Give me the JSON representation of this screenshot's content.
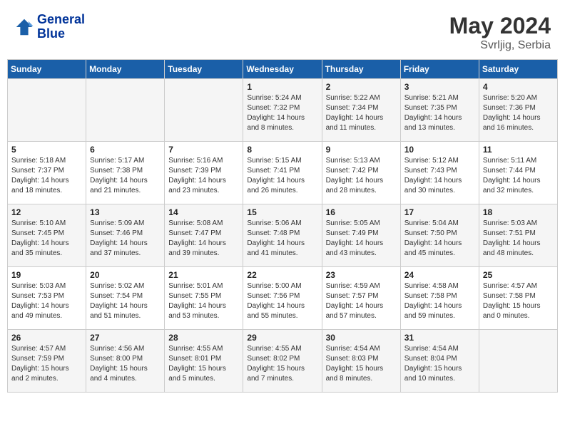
{
  "header": {
    "logo_line1": "General",
    "logo_line2": "Blue",
    "month_year": "May 2024",
    "location": "Svrljig, Serbia"
  },
  "days_of_week": [
    "Sunday",
    "Monday",
    "Tuesday",
    "Wednesday",
    "Thursday",
    "Friday",
    "Saturday"
  ],
  "weeks": [
    [
      {
        "day": "",
        "sunrise": "",
        "sunset": "",
        "daylight": ""
      },
      {
        "day": "",
        "sunrise": "",
        "sunset": "",
        "daylight": ""
      },
      {
        "day": "",
        "sunrise": "",
        "sunset": "",
        "daylight": ""
      },
      {
        "day": "1",
        "sunrise": "Sunrise: 5:24 AM",
        "sunset": "Sunset: 7:32 PM",
        "daylight": "Daylight: 14 hours and 8 minutes."
      },
      {
        "day": "2",
        "sunrise": "Sunrise: 5:22 AM",
        "sunset": "Sunset: 7:34 PM",
        "daylight": "Daylight: 14 hours and 11 minutes."
      },
      {
        "day": "3",
        "sunrise": "Sunrise: 5:21 AM",
        "sunset": "Sunset: 7:35 PM",
        "daylight": "Daylight: 14 hours and 13 minutes."
      },
      {
        "day": "4",
        "sunrise": "Sunrise: 5:20 AM",
        "sunset": "Sunset: 7:36 PM",
        "daylight": "Daylight: 14 hours and 16 minutes."
      }
    ],
    [
      {
        "day": "5",
        "sunrise": "Sunrise: 5:18 AM",
        "sunset": "Sunset: 7:37 PM",
        "daylight": "Daylight: 14 hours and 18 minutes."
      },
      {
        "day": "6",
        "sunrise": "Sunrise: 5:17 AM",
        "sunset": "Sunset: 7:38 PM",
        "daylight": "Daylight: 14 hours and 21 minutes."
      },
      {
        "day": "7",
        "sunrise": "Sunrise: 5:16 AM",
        "sunset": "Sunset: 7:39 PM",
        "daylight": "Daylight: 14 hours and 23 minutes."
      },
      {
        "day": "8",
        "sunrise": "Sunrise: 5:15 AM",
        "sunset": "Sunset: 7:41 PM",
        "daylight": "Daylight: 14 hours and 26 minutes."
      },
      {
        "day": "9",
        "sunrise": "Sunrise: 5:13 AM",
        "sunset": "Sunset: 7:42 PM",
        "daylight": "Daylight: 14 hours and 28 minutes."
      },
      {
        "day": "10",
        "sunrise": "Sunrise: 5:12 AM",
        "sunset": "Sunset: 7:43 PM",
        "daylight": "Daylight: 14 hours and 30 minutes."
      },
      {
        "day": "11",
        "sunrise": "Sunrise: 5:11 AM",
        "sunset": "Sunset: 7:44 PM",
        "daylight": "Daylight: 14 hours and 32 minutes."
      }
    ],
    [
      {
        "day": "12",
        "sunrise": "Sunrise: 5:10 AM",
        "sunset": "Sunset: 7:45 PM",
        "daylight": "Daylight: 14 hours and 35 minutes."
      },
      {
        "day": "13",
        "sunrise": "Sunrise: 5:09 AM",
        "sunset": "Sunset: 7:46 PM",
        "daylight": "Daylight: 14 hours and 37 minutes."
      },
      {
        "day": "14",
        "sunrise": "Sunrise: 5:08 AM",
        "sunset": "Sunset: 7:47 PM",
        "daylight": "Daylight: 14 hours and 39 minutes."
      },
      {
        "day": "15",
        "sunrise": "Sunrise: 5:06 AM",
        "sunset": "Sunset: 7:48 PM",
        "daylight": "Daylight: 14 hours and 41 minutes."
      },
      {
        "day": "16",
        "sunrise": "Sunrise: 5:05 AM",
        "sunset": "Sunset: 7:49 PM",
        "daylight": "Daylight: 14 hours and 43 minutes."
      },
      {
        "day": "17",
        "sunrise": "Sunrise: 5:04 AM",
        "sunset": "Sunset: 7:50 PM",
        "daylight": "Daylight: 14 hours and 45 minutes."
      },
      {
        "day": "18",
        "sunrise": "Sunrise: 5:03 AM",
        "sunset": "Sunset: 7:51 PM",
        "daylight": "Daylight: 14 hours and 48 minutes."
      }
    ],
    [
      {
        "day": "19",
        "sunrise": "Sunrise: 5:03 AM",
        "sunset": "Sunset: 7:53 PM",
        "daylight": "Daylight: 14 hours and 49 minutes."
      },
      {
        "day": "20",
        "sunrise": "Sunrise: 5:02 AM",
        "sunset": "Sunset: 7:54 PM",
        "daylight": "Daylight: 14 hours and 51 minutes."
      },
      {
        "day": "21",
        "sunrise": "Sunrise: 5:01 AM",
        "sunset": "Sunset: 7:55 PM",
        "daylight": "Daylight: 14 hours and 53 minutes."
      },
      {
        "day": "22",
        "sunrise": "Sunrise: 5:00 AM",
        "sunset": "Sunset: 7:56 PM",
        "daylight": "Daylight: 14 hours and 55 minutes."
      },
      {
        "day": "23",
        "sunrise": "Sunrise: 4:59 AM",
        "sunset": "Sunset: 7:57 PM",
        "daylight": "Daylight: 14 hours and 57 minutes."
      },
      {
        "day": "24",
        "sunrise": "Sunrise: 4:58 AM",
        "sunset": "Sunset: 7:58 PM",
        "daylight": "Daylight: 14 hours and 59 minutes."
      },
      {
        "day": "25",
        "sunrise": "Sunrise: 4:57 AM",
        "sunset": "Sunset: 7:58 PM",
        "daylight": "Daylight: 15 hours and 0 minutes."
      }
    ],
    [
      {
        "day": "26",
        "sunrise": "Sunrise: 4:57 AM",
        "sunset": "Sunset: 7:59 PM",
        "daylight": "Daylight: 15 hours and 2 minutes."
      },
      {
        "day": "27",
        "sunrise": "Sunrise: 4:56 AM",
        "sunset": "Sunset: 8:00 PM",
        "daylight": "Daylight: 15 hours and 4 minutes."
      },
      {
        "day": "28",
        "sunrise": "Sunrise: 4:55 AM",
        "sunset": "Sunset: 8:01 PM",
        "daylight": "Daylight: 15 hours and 5 minutes."
      },
      {
        "day": "29",
        "sunrise": "Sunrise: 4:55 AM",
        "sunset": "Sunset: 8:02 PM",
        "daylight": "Daylight: 15 hours and 7 minutes."
      },
      {
        "day": "30",
        "sunrise": "Sunrise: 4:54 AM",
        "sunset": "Sunset: 8:03 PM",
        "daylight": "Daylight: 15 hours and 8 minutes."
      },
      {
        "day": "31",
        "sunrise": "Sunrise: 4:54 AM",
        "sunset": "Sunset: 8:04 PM",
        "daylight": "Daylight: 15 hours and 10 minutes."
      },
      {
        "day": "",
        "sunrise": "",
        "sunset": "",
        "daylight": ""
      }
    ]
  ]
}
